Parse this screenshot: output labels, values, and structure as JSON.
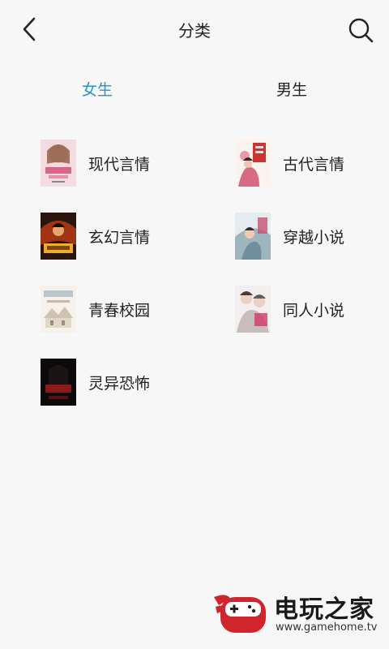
{
  "header": {
    "title": "分类",
    "back_icon": "chevron-left-icon",
    "search_icon": "search-icon"
  },
  "tabs": [
    {
      "label": "女生",
      "active": true
    },
    {
      "label": "男生",
      "active": false
    }
  ],
  "categories": [
    {
      "label": "现代言情"
    },
    {
      "label": "古代言情"
    },
    {
      "label": "玄幻言情"
    },
    {
      "label": "穿越小说"
    },
    {
      "label": "青春校园"
    },
    {
      "label": "同人小说"
    },
    {
      "label": "灵异恐怖"
    }
  ],
  "colors": {
    "accent": "#2a92c9",
    "background": "#f7f7f7",
    "text": "#222222"
  },
  "watermark": {
    "name": "电玩之家",
    "url": "www.gamehome.tv"
  }
}
